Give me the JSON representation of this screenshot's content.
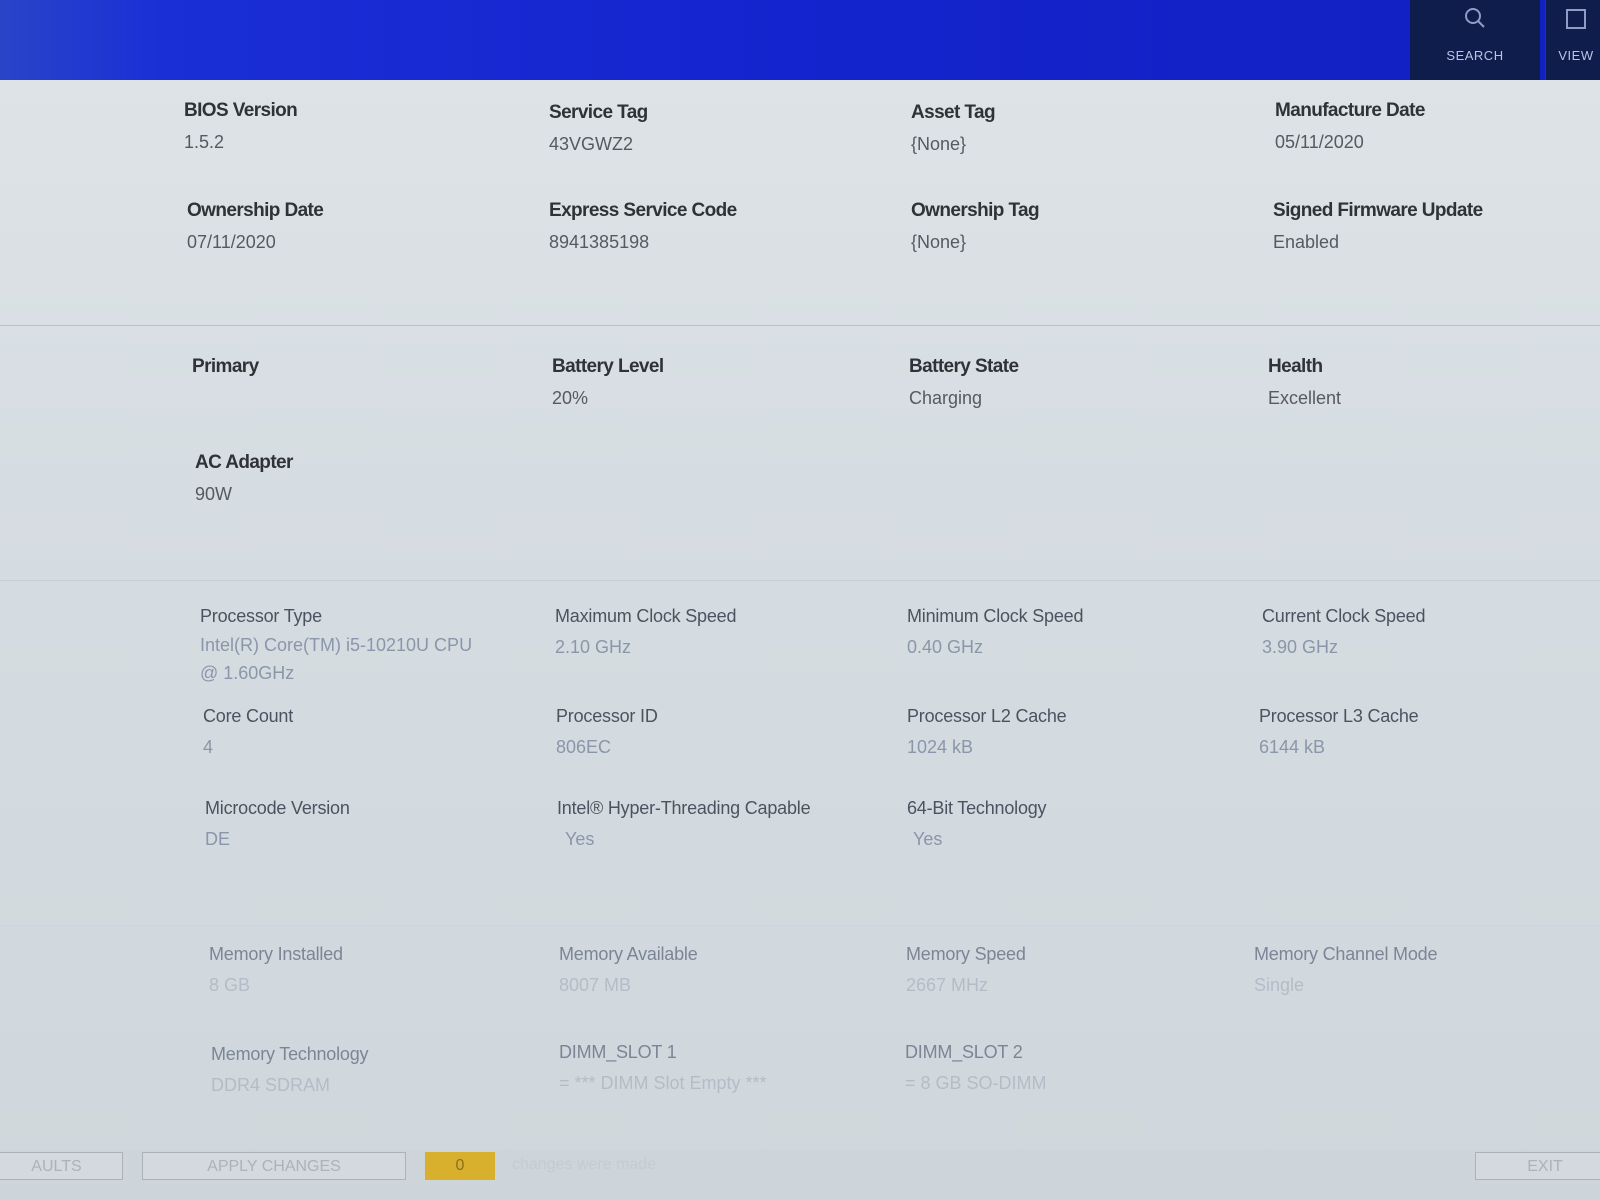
{
  "header": {
    "search_label": "SEARCH",
    "view_label": "VIEW",
    "search_icon": "search-icon",
    "view_icon": "view-icon"
  },
  "system_info": {
    "bios_version": {
      "label": "BIOS Version",
      "value": "1.5.2"
    },
    "service_tag": {
      "label": "Service Tag",
      "value": "43VGWZ2"
    },
    "asset_tag": {
      "label": "Asset Tag",
      "value": "{None}"
    },
    "manufacture_date": {
      "label": "Manufacture Date",
      "value": "05/11/2020"
    },
    "ownership_date": {
      "label": "Ownership Date",
      "value": "07/11/2020"
    },
    "express_service_code": {
      "label": "Express Service Code",
      "value": "8941385198"
    },
    "ownership_tag": {
      "label": "Ownership Tag",
      "value": "{None}"
    },
    "signed_firmware_update": {
      "label": "Signed Firmware Update",
      "value": "Enabled"
    }
  },
  "battery": {
    "primary": {
      "label": "Primary"
    },
    "battery_level": {
      "label": "Battery Level",
      "value": "20%"
    },
    "battery_state": {
      "label": "Battery State",
      "value": "Charging"
    },
    "health": {
      "label": "Health",
      "value": "Excellent"
    },
    "ac_adapter": {
      "label": "AC Adapter",
      "value": "90W"
    }
  },
  "processor": {
    "processor_type": {
      "label": "Processor Type",
      "value": "Intel(R) Core(TM) i5-10210U CPU @ 1.60GHz"
    },
    "max_clock": {
      "label": "Maximum Clock Speed",
      "value": "2.10 GHz"
    },
    "min_clock": {
      "label": "Minimum Clock Speed",
      "value": "0.40 GHz"
    },
    "current_clock": {
      "label": "Current Clock Speed",
      "value": "3.90 GHz"
    },
    "core_count": {
      "label": "Core Count",
      "value": "4"
    },
    "processor_id": {
      "label": "Processor ID",
      "value": "806EC"
    },
    "l2_cache": {
      "label": "Processor L2 Cache",
      "value": "1024 kB"
    },
    "l3_cache": {
      "label": "Processor L3 Cache",
      "value": "6144 kB"
    },
    "microcode_version": {
      "label": "Microcode Version",
      "value": "DE"
    },
    "hyper_threading": {
      "label": "Intel® Hyper-Threading Capable",
      "value": "Yes"
    },
    "bit64": {
      "label": "64-Bit Technology",
      "value": "Yes"
    }
  },
  "memory": {
    "installed": {
      "label": "Memory Installed",
      "value": "8 GB"
    },
    "available": {
      "label": "Memory Available",
      "value": "8007 MB"
    },
    "speed": {
      "label": "Memory Speed",
      "value": "2667 MHz"
    },
    "channel_mode": {
      "label": "Memory Channel Mode",
      "value": "Single"
    },
    "technology": {
      "label": "Memory Technology",
      "value": "DDR4 SDRAM"
    },
    "dimm1": {
      "label": "DIMM_SLOT 1",
      "value": "= *** DIMM Slot Empty ***"
    },
    "dimm2": {
      "label": "DIMM_SLOT 2",
      "value": "= 8 GB SO-DIMM"
    }
  },
  "footer": {
    "defaults_label": "AULTS",
    "apply_label": "APPLY CHANGES",
    "changes_count": "0",
    "changes_text": "changes were made",
    "exit_label": "EXIT"
  }
}
